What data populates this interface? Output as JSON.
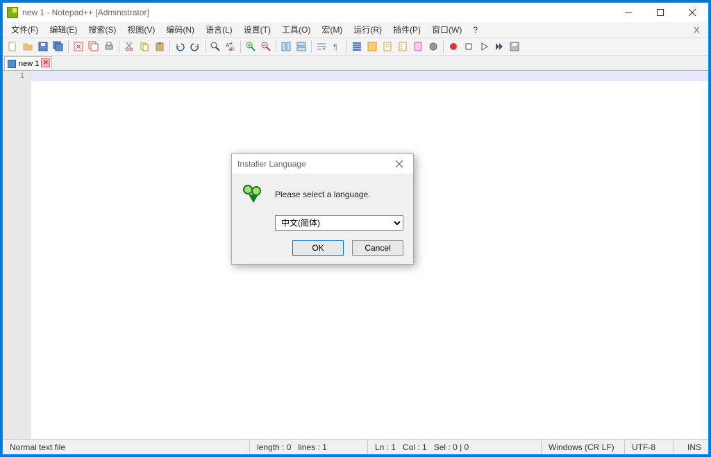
{
  "titlebar": {
    "title": "new 1 - Notepad++ [Administrator]"
  },
  "menubar": {
    "items": [
      {
        "label": "文件(F)"
      },
      {
        "label": "编辑(E)"
      },
      {
        "label": "搜索(S)"
      },
      {
        "label": "视图(V)"
      },
      {
        "label": "编码(N)"
      },
      {
        "label": "语言(L)"
      },
      {
        "label": "设置(T)"
      },
      {
        "label": "工具(O)"
      },
      {
        "label": "宏(M)"
      },
      {
        "label": "运行(R)"
      },
      {
        "label": "插件(P)"
      },
      {
        "label": "窗口(W)"
      },
      {
        "label": "?"
      }
    ]
  },
  "tabs": {
    "active": {
      "label": "new 1"
    }
  },
  "editor": {
    "line_number": "1"
  },
  "statusbar": {
    "filetype": "Normal text file",
    "length": "length : 0",
    "lines": "lines : 1",
    "ln": "Ln : 1",
    "col": "Col : 1",
    "sel": "Sel : 0 | 0",
    "eol": "Windows (CR LF)",
    "encoding": "UTF-8",
    "ins": "INS"
  },
  "dialog": {
    "title": "Installer Language",
    "message": "Please select a language.",
    "selected_language": "中文(简体)",
    "ok_label": "OK",
    "cancel_label": "Cancel"
  }
}
